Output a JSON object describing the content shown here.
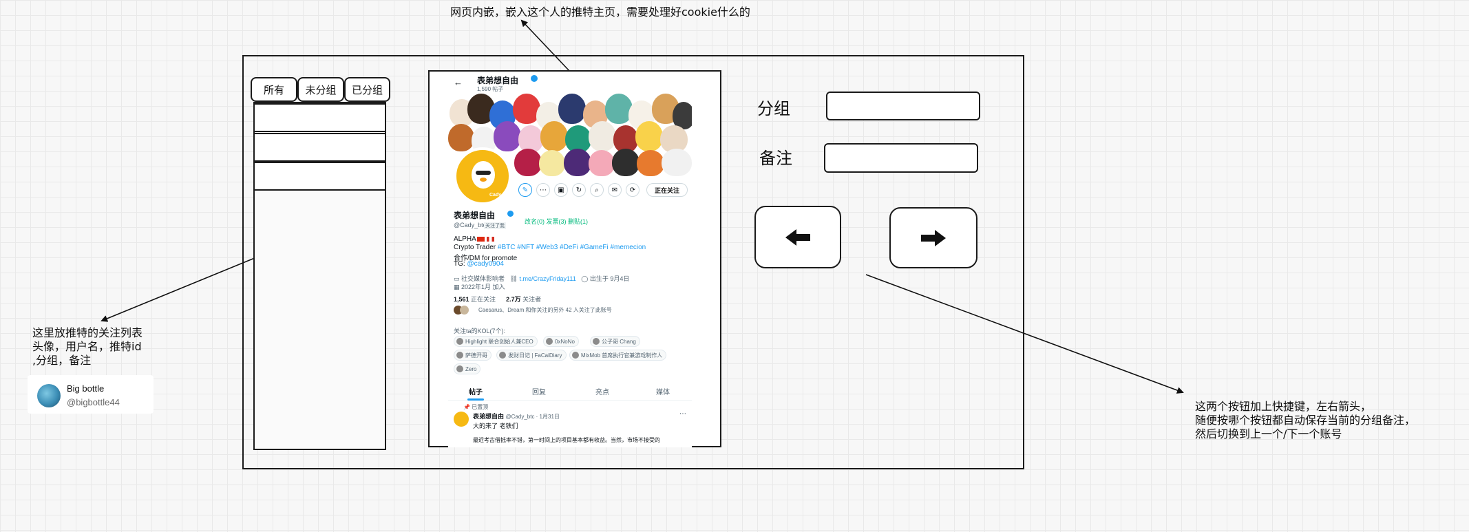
{
  "top_note": "网页内嵌，嵌入这个人的推特主页，需要处理好cookie什么的",
  "tabs": [
    {
      "label": "所有"
    },
    {
      "label": "未分组"
    },
    {
      "label": "已分组"
    }
  ],
  "left_note": {
    "line1": "这里放推特的关注列表",
    "line2": "头像，用户名，推特id",
    "line3": ",分组，备注"
  },
  "sample_user": {
    "name": "Big bottle",
    "handle": "@bigbottle44"
  },
  "twitter": {
    "header_name": "表弟想自由",
    "post_count": "1,590 帖子",
    "display_name": "表弟想自由",
    "handle": "@Cady_btc",
    "follows_you": "关注了我",
    "green_stats": "改名(0)  发票(3)  删贴(1)",
    "bio_line1": "ALPHA",
    "bio_line2_prefix": "Crypto Trader",
    "bio_line2_tags": "#BTC #NFT #Web3 #DeFi #GameFi #memecion",
    "bio_line3": "合作/DM for promote",
    "bio_line4_prefix": "TG:",
    "bio_line4_link": "@cady0904",
    "meta_category": "社交媒体影响者",
    "meta_link": "t.me/CrazyFriday111",
    "meta_birthday": "出生于 9月4日",
    "meta_joined": "2022年1月 加入",
    "following_count": "1,561",
    "following_label": "正在关注",
    "followers_count": "2.7万",
    "followers_label": "关注者",
    "followed_by": "Caesarus、Dream 和你关注的另外 42 人关注了此账号",
    "follow_button": "正在关注",
    "avatar_caption": "Cady",
    "kol_title": "关注ta的KOL(7个):",
    "kol_chips": [
      "Highlight 联合创始人兼CEO",
      "0xNoNo",
      "公子哥 Chang",
      "萨德开哥",
      "发财日记 | FaCaiDiary",
      "MixMob 首席执行官兼游戏制作人",
      "Zero"
    ],
    "tab_labels": [
      "帖子",
      "回复",
      "亮点",
      "媒体"
    ],
    "pinned_label": "已置顶",
    "post_author": "表弟想自由",
    "post_meta": "@Cady_btc · 1月31日",
    "post_line1": "大的来了 老铁们",
    "post_line2": "最近考古借抵率不错，第一时间上的项目基本都有收益。当然，市场不接受的"
  },
  "form": {
    "group_label": "分组",
    "note_label": "备注",
    "group_value": "",
    "note_value": ""
  },
  "buttons": {
    "prev_icon": "arrow-left-icon",
    "next_icon": "arrow-right-icon"
  },
  "right_note": {
    "line1": "这两个按钮加上快捷键，左右箭头，",
    "line2": "随便按哪个按钮都自动保存当前的分组备注，",
    "line3": "然后切换到上一个/下一个账号"
  }
}
